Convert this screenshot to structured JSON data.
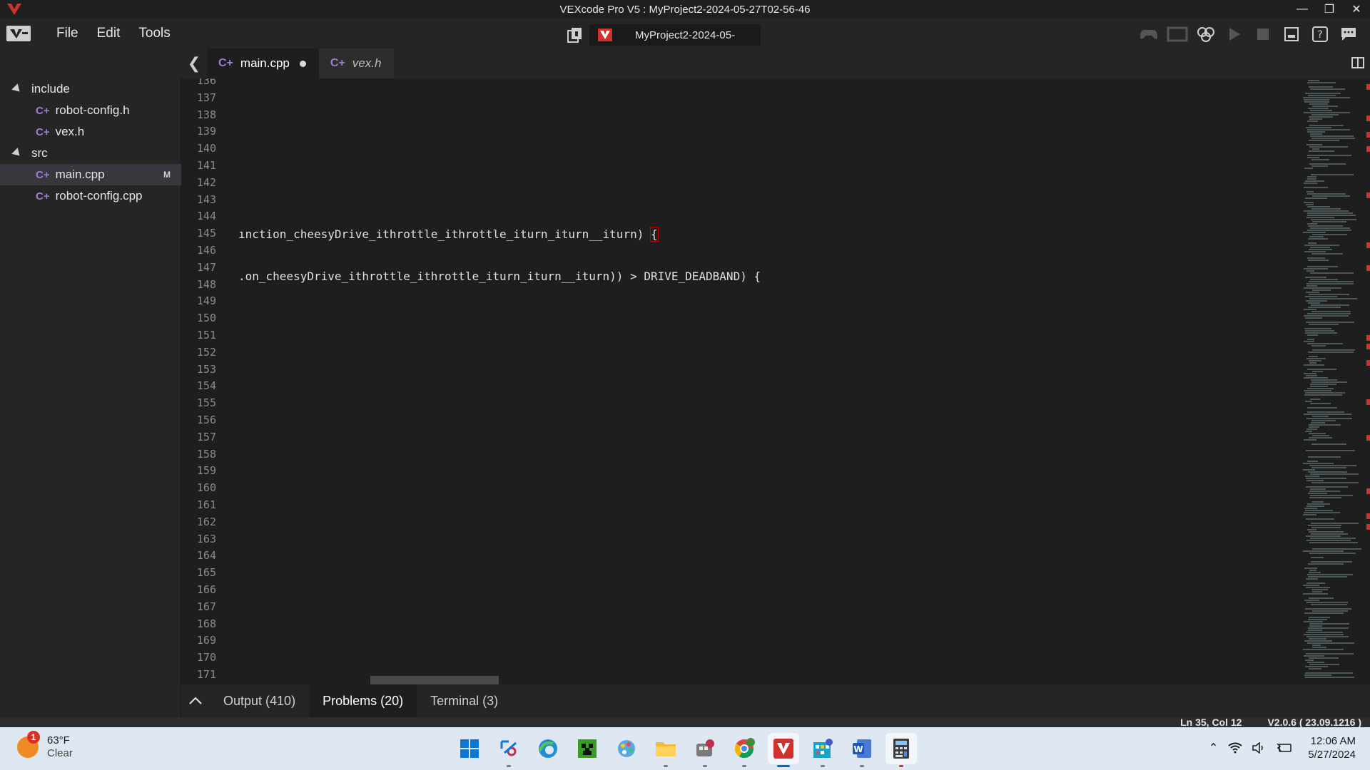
{
  "window": {
    "title": "VEXcode Pro V5 : MyProject2-2024-05-27T02-56-46"
  },
  "menu": {
    "items": [
      "File",
      "Edit",
      "Tools"
    ],
    "project_name": "MyProject2-2024-05-"
  },
  "tabs": [
    {
      "label": "main.cpp",
      "modified": true
    },
    {
      "label": "vex.h",
      "modified": false
    }
  ],
  "explorer": {
    "folders": [
      {
        "label": "include",
        "files": [
          "robot-config.h",
          "vex.h"
        ]
      },
      {
        "label": "src",
        "files": [
          "main.cpp",
          "robot-config.cpp"
        ]
      }
    ],
    "modified_badge": "M"
  },
  "editor": {
    "line_numbers": [
      "136",
      "137",
      "138",
      "139",
      "140",
      "141",
      "142",
      "143",
      "144",
      "145",
      "146",
      "147",
      "148",
      "149",
      "150",
      "151",
      "152",
      "153",
      "154",
      "155",
      "156",
      "157",
      "158",
      "159",
      "160",
      "161",
      "162",
      "163",
      "164",
      "165",
      "166",
      "167",
      "168",
      "169",
      "170",
      "171"
    ],
    "line_145": "ınction_cheesyDrive_ithrottle_ithrottle_iturn_iturn__iturn) ",
    "line_145_brace": "{",
    "line_148": ".on_cheesyDrive_ithrottle_ithrottle_iturn_iturn__iturn)) > DRIVE_DEADBAND) {"
  },
  "panel": {
    "tabs": [
      "Output (410)",
      "Problems (20)",
      "Terminal (3)"
    ],
    "active": "Problems (20)"
  },
  "status": {
    "position": "Ln 35, Col 12",
    "version": "V2.0.6 ( 23.09.1216 )"
  },
  "taskbar": {
    "weather_temp": "63°F",
    "weather_desc": "Clear",
    "weather_badge": "1",
    "time": "12:06 AM",
    "date": "5/27/2024"
  },
  "colors": {
    "accent_red": "#d0312d",
    "cpp_icon": "#a179d6"
  }
}
